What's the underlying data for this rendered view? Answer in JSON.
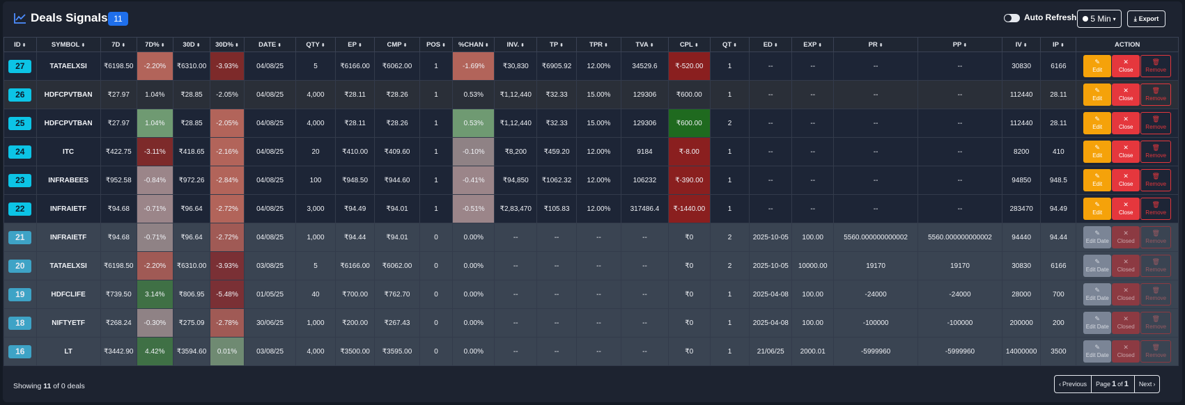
{
  "header": {
    "title": "Deals Signals",
    "count": "11",
    "auto_refresh_label": "Auto Refresh",
    "interval": "5 Min",
    "export_label": "Export",
    "title_icon": "chart-line-icon"
  },
  "columns": [
    "ID",
    "SYMBOL",
    "7D",
    "7D%",
    "30D",
    "30D%",
    "DATE",
    "QTY",
    "EP",
    "CMP",
    "POS",
    "%CHAN",
    "INV.",
    "TP",
    "TPR",
    "TVA",
    "CPL",
    "QT",
    "ED",
    "EXP",
    "PR",
    "PP",
    "IV",
    "IP",
    "ACTION"
  ],
  "sortable": [
    true,
    true,
    true,
    true,
    true,
    true,
    true,
    true,
    true,
    true,
    true,
    true,
    true,
    true,
    true,
    true,
    true,
    true,
    true,
    true,
    true,
    true,
    true,
    true,
    false
  ],
  "actions": {
    "active": {
      "edit": "Edit",
      "close": "Close",
      "remove": "Remove"
    },
    "closed": {
      "edit": "Edit Date",
      "close": "Closed",
      "remove": "Remove"
    }
  },
  "rows": [
    {
      "id": "27",
      "symbol": "TATAELXSI",
      "d7": "₹6198.50",
      "d7p": "-2.20%",
      "d30": "₹6310.00",
      "d30p": "-3.93%",
      "date": "04/08/25",
      "qty": "5",
      "ep": "₹6166.00",
      "cmp": "₹6062.00",
      "pos": "1",
      "chan": "-1.69%",
      "inv": "₹30,830",
      "tp": "₹6905.92",
      "tpr": "12.00%",
      "tva": "34529.6",
      "cpl": "₹-520.00",
      "qt": "1",
      "ed": "--",
      "exp": "--",
      "pr": "--",
      "pp": "--",
      "iv": "30830",
      "ip": "6166",
      "status": "active",
      "style": "active",
      "colors": {
        "d7p": "#b2645a",
        "d30p": "#7d2a2a",
        "chan": "#b2645a",
        "cpl": "#8a1f1f"
      }
    },
    {
      "id": "26",
      "symbol": "HDFCPVTBAN",
      "d7": "₹27.97",
      "d7p": "1.04%",
      "d30": "₹28.85",
      "d30p": "-2.05%",
      "date": "04/08/25",
      "qty": "4,000",
      "ep": "₹28.11",
      "cmp": "₹28.26",
      "pos": "1",
      "chan": "0.53%",
      "inv": "₹1,12,440",
      "tp": "₹32.33",
      "tpr": "15.00%",
      "tva": "129306",
      "cpl": "₹600.00",
      "qt": "1",
      "ed": "--",
      "exp": "--",
      "pr": "--",
      "pp": "--",
      "iv": "112440",
      "ip": "28.11",
      "status": "active",
      "style": "alt",
      "colors": {
        "d7p": "#2a2f38",
        "d30p": "#2a2f38",
        "chan": "#2a2f38",
        "cpl": "#2a2f38"
      }
    },
    {
      "id": "25",
      "symbol": "HDFCPVTBAN",
      "d7": "₹27.97",
      "d7p": "1.04%",
      "d30": "₹28.85",
      "d30p": "-2.05%",
      "date": "04/08/25",
      "qty": "4,000",
      "ep": "₹28.11",
      "cmp": "₹28.26",
      "pos": "1",
      "chan": "0.53%",
      "inv": "₹1,12,440",
      "tp": "₹32.33",
      "tpr": "15.00%",
      "tva": "129306",
      "cpl": "₹600.00",
      "qt": "2",
      "ed": "--",
      "exp": "--",
      "pr": "--",
      "pp": "--",
      "iv": "112440",
      "ip": "28.11",
      "status": "active",
      "style": "active",
      "colors": {
        "d7p": "#6f9a72",
        "d30p": "#b2645a",
        "chan": "#6f9a72",
        "cpl": "#1f6a1f"
      }
    },
    {
      "id": "24",
      "symbol": "ITC",
      "d7": "₹422.75",
      "d7p": "-3.11%",
      "d30": "₹418.65",
      "d30p": "-2.16%",
      "date": "04/08/25",
      "qty": "20",
      "ep": "₹410.00",
      "cmp": "₹409.60",
      "pos": "1",
      "chan": "-0.10%",
      "inv": "₹8,200",
      "tp": "₹459.20",
      "tpr": "12.00%",
      "tva": "9184",
      "cpl": "₹-8.00",
      "qt": "1",
      "ed": "--",
      "exp": "--",
      "pr": "--",
      "pp": "--",
      "iv": "8200",
      "ip": "410",
      "status": "active",
      "style": "active",
      "colors": {
        "d7p": "#7d2a2a",
        "d30p": "#b2645a",
        "chan": "#8f8285",
        "cpl": "#8a1f1f"
      }
    },
    {
      "id": "23",
      "symbol": "INFRABEES",
      "d7": "₹952.58",
      "d7p": "-0.84%",
      "d30": "₹972.26",
      "d30p": "-2.84%",
      "date": "04/08/25",
      "qty": "100",
      "ep": "₹948.50",
      "cmp": "₹944.60",
      "pos": "1",
      "chan": "-0.41%",
      "inv": "₹94,850",
      "tp": "₹1062.32",
      "tpr": "12.00%",
      "tva": "106232",
      "cpl": "₹-390.00",
      "qt": "1",
      "ed": "--",
      "exp": "--",
      "pr": "--",
      "pp": "--",
      "iv": "94850",
      "ip": "948.5",
      "status": "active",
      "style": "active",
      "colors": {
        "d7p": "#9b8589",
        "d30p": "#b2645a",
        "chan": "#9b8589",
        "cpl": "#8a1f1f"
      }
    },
    {
      "id": "22",
      "symbol": "INFRAIETF",
      "d7": "₹94.68",
      "d7p": "-0.71%",
      "d30": "₹96.64",
      "d30p": "-2.72%",
      "date": "04/08/25",
      "qty": "3,000",
      "ep": "₹94.49",
      "cmp": "₹94.01",
      "pos": "1",
      "chan": "-0.51%",
      "inv": "₹2,83,470",
      "tp": "₹105.83",
      "tpr": "12.00%",
      "tva": "317486.4",
      "cpl": "₹-1440.00",
      "qt": "1",
      "ed": "--",
      "exp": "--",
      "pr": "--",
      "pp": "--",
      "iv": "283470",
      "ip": "94.49",
      "status": "active",
      "style": "active",
      "colors": {
        "d7p": "#9b8589",
        "d30p": "#b2645a",
        "chan": "#9b8589",
        "cpl": "#8a1f1f"
      }
    },
    {
      "id": "21",
      "symbol": "INFRAIETF",
      "d7": "₹94.68",
      "d7p": "-0.71%",
      "d30": "₹96.64",
      "d30p": "-2.72%",
      "date": "04/08/25",
      "qty": "1,000",
      "ep": "₹94.44",
      "cmp": "₹94.01",
      "pos": "0",
      "chan": "0.00%",
      "inv": "--",
      "tp": "--",
      "tpr": "--",
      "tva": "--",
      "cpl": "₹0",
      "qt": "2",
      "ed": "2025-10-05",
      "exp": "100.00",
      "pr": "5560.000000000002",
      "pp": "5560.000000000002",
      "iv": "94440",
      "ip": "94.44",
      "status": "closed",
      "style": "closed",
      "colors": {
        "d7p": "#8f8285",
        "d30p": "#a05a55",
        "chan": "#3a4452",
        "cpl": "#3a4452"
      }
    },
    {
      "id": "20",
      "symbol": "TATAELXSI",
      "d7": "₹6198.50",
      "d7p": "-2.20%",
      "d30": "₹6310.00",
      "d30p": "-3.93%",
      "date": "03/08/25",
      "qty": "5",
      "ep": "₹6166.00",
      "cmp": "₹6062.00",
      "pos": "0",
      "chan": "0.00%",
      "inv": "--",
      "tp": "--",
      "tpr": "--",
      "tva": "--",
      "cpl": "₹0",
      "qt": "2",
      "ed": "2025-10-05",
      "exp": "10000.00",
      "pr": "19170",
      "pp": "19170",
      "iv": "30830",
      "ip": "6166",
      "status": "closed",
      "style": "closed",
      "colors": {
        "d7p": "#a05a55",
        "d30p": "#7a3035",
        "chan": "#3a4452",
        "cpl": "#3a4452"
      }
    },
    {
      "id": "19",
      "symbol": "HDFCLIFE",
      "d7": "₹739.50",
      "d7p": "3.14%",
      "d30": "₹806.95",
      "d30p": "-5.48%",
      "date": "01/05/25",
      "qty": "40",
      "ep": "₹700.00",
      "cmp": "₹762.70",
      "pos": "0",
      "chan": "0.00%",
      "inv": "--",
      "tp": "--",
      "tpr": "--",
      "tva": "--",
      "cpl": "₹0",
      "qt": "1",
      "ed": "2025-04-08",
      "exp": "100.00",
      "pr": "-24000",
      "pp": "-24000",
      "iv": "28000",
      "ip": "700",
      "status": "closed",
      "style": "closed",
      "colors": {
        "d7p": "#3f7045",
        "d30p": "#7a3035",
        "chan": "#3a4452",
        "cpl": "#3a4452"
      }
    },
    {
      "id": "18",
      "symbol": "NIFTYETF",
      "d7": "₹268.24",
      "d7p": "-0.30%",
      "d30": "₹275.09",
      "d30p": "-2.78%",
      "date": "30/06/25",
      "qty": "1,000",
      "ep": "₹200.00",
      "cmp": "₹267.43",
      "pos": "0",
      "chan": "0.00%",
      "inv": "--",
      "tp": "--",
      "tpr": "--",
      "tva": "--",
      "cpl": "₹0",
      "qt": "1",
      "ed": "2025-04-08",
      "exp": "100.00",
      "pr": "-100000",
      "pp": "-100000",
      "iv": "200000",
      "ip": "200",
      "status": "closed",
      "style": "closed",
      "colors": {
        "d7p": "#8f8285",
        "d30p": "#a05a55",
        "chan": "#3a4452",
        "cpl": "#3a4452"
      }
    },
    {
      "id": "16",
      "symbol": "LT",
      "d7": "₹3442.90",
      "d7p": "4.42%",
      "d30": "₹3594.60",
      "d30p": "0.01%",
      "date": "03/08/25",
      "qty": "4,000",
      "ep": "₹3500.00",
      "cmp": "₹3595.00",
      "pos": "0",
      "chan": "0.00%",
      "inv": "--",
      "tp": "--",
      "tpr": "--",
      "tva": "--",
      "cpl": "₹0",
      "qt": "1",
      "ed": "21/06/25",
      "exp": "2000.01",
      "pr": "-5999960",
      "pp": "-5999960",
      "iv": "14000000",
      "ip": "3500",
      "status": "closed",
      "style": "closed",
      "colors": {
        "d7p": "#3f7045",
        "d30p": "#6f8a72",
        "chan": "#3a4452",
        "cpl": "#3a4452"
      }
    }
  ],
  "footer": {
    "showing_prefix": "Showing",
    "showing_count": "11",
    "showing_suffix": "of 0 deals",
    "prev_label": "Previous",
    "page_prefix": "Page",
    "page_current": "1",
    "page_of": "of",
    "page_total": "1",
    "next_label": "Next"
  }
}
